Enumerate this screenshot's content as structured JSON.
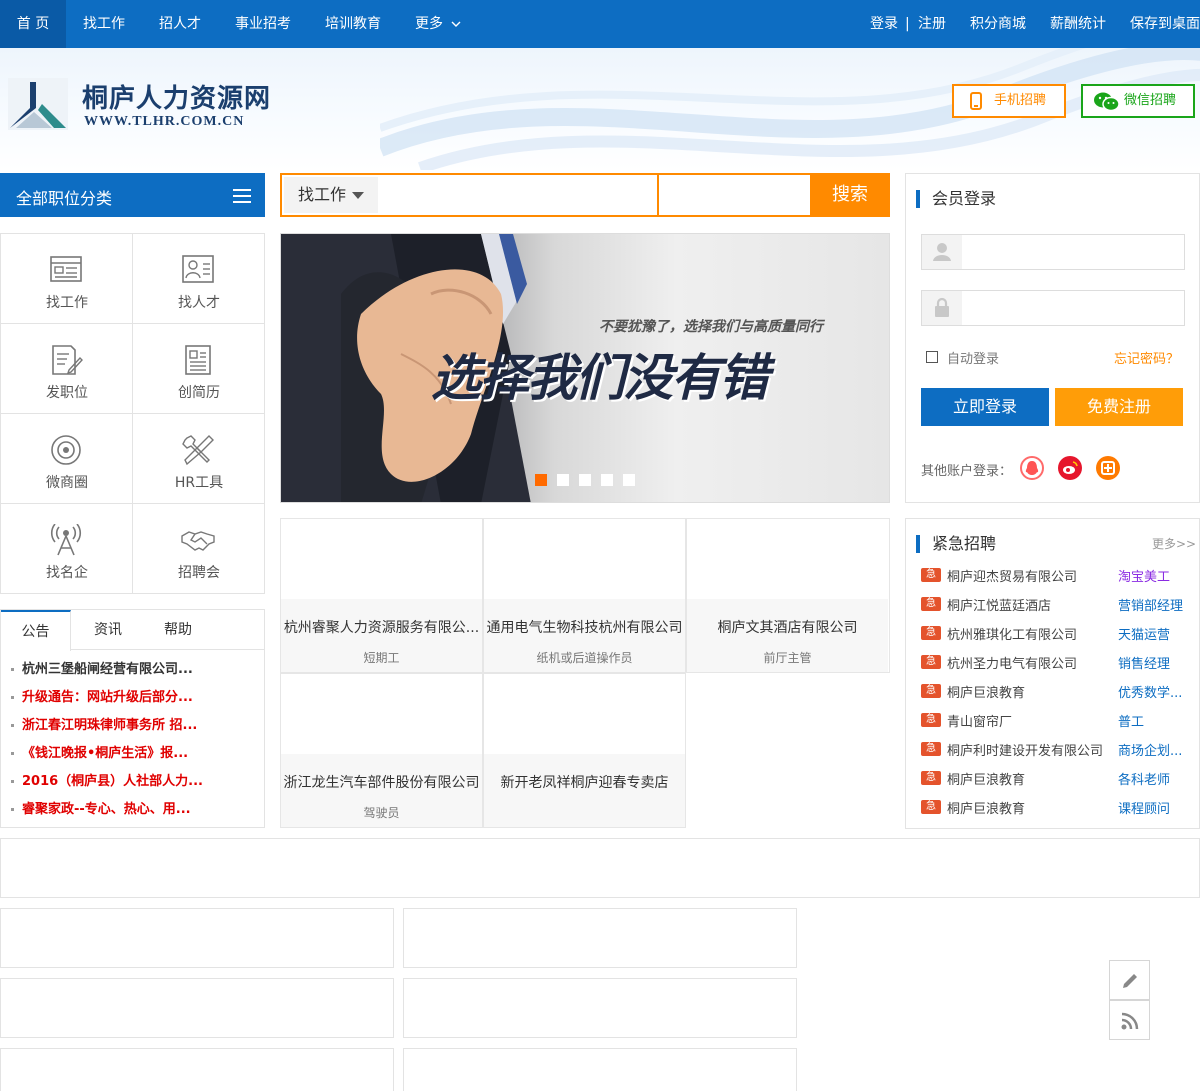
{
  "nav": {
    "items": [
      "首 页",
      "找工作",
      "招人才",
      "事业招考",
      "培训教育",
      "更多"
    ],
    "right": {
      "login": "登录",
      "sep": "|",
      "register": "注册",
      "points": "积分商城",
      "salary": "薪酬统计",
      "desktop": "保存到桌面"
    }
  },
  "header": {
    "logo_cn": "桐庐人力资源网",
    "logo_en": "WWW.TLHR.COM.CN",
    "mobile": "手机招聘",
    "wechat": "微信招聘"
  },
  "category": {
    "title": "全部职位分类",
    "cells": [
      {
        "label": "找工作",
        "icon": "job-search-icon"
      },
      {
        "label": "找人才",
        "icon": "resume-card-icon"
      },
      {
        "label": "发职位",
        "icon": "post-job-icon"
      },
      {
        "label": "创简历",
        "icon": "create-resume-icon"
      },
      {
        "label": "微商圈",
        "icon": "target-icon"
      },
      {
        "label": "HR工具",
        "icon": "tools-icon"
      },
      {
        "label": "找名企",
        "icon": "tower-icon"
      },
      {
        "label": "招聘会",
        "icon": "handshake-icon"
      }
    ]
  },
  "news": {
    "tabs": [
      "公告",
      "资讯",
      "帮助"
    ],
    "items": [
      {
        "text": "杭州三堡船闸经营有限公司...",
        "color": "#333333"
      },
      {
        "text": "升级通告：网站升级后部分...",
        "color": "#e00000"
      },
      {
        "text": "浙江春江明珠律师事务所 招...",
        "color": "#e00000"
      },
      {
        "text": "《钱江晚报•桐庐生活》报...",
        "color": "#e00000"
      },
      {
        "text": "2016（桐庐县）人社部人力...",
        "color": "#e00000"
      },
      {
        "text": "睿聚家政--专心、热心、用...",
        "color": "#e00000"
      }
    ]
  },
  "search": {
    "type": "找工作",
    "button": "搜索"
  },
  "banner": {
    "slogan": "选择我们没有错",
    "sub": "不要犹豫了，选择我们与高质量同行"
  },
  "companies": [
    {
      "name": "杭州睿聚人力资源服务有限公...",
      "job": "短期工"
    },
    {
      "name": "通用电气生物科技杭州有限公司",
      "job": "纸机或后道操作员"
    },
    {
      "name": "桐庐文其酒店有限公司",
      "job": "前厅主管"
    },
    {
      "name": "浙江龙生汽车部件股份有限公司",
      "job": "驾驶员"
    },
    {
      "name": "新开老凤祥桐庐迎春专卖店",
      "job": ""
    }
  ],
  "login": {
    "title": "会员登录",
    "auto": "自动登录",
    "forgot": "忘记密码？",
    "login_btn": "立即登录",
    "register_btn": "免费注册",
    "other": "其他账户登录："
  },
  "urgent": {
    "title": "紧急招聘",
    "more": "更多>>",
    "tag": "急",
    "items": [
      {
        "company": "桐庐迎杰贸易有限公司",
        "job": "淘宝美工",
        "color": "#8a2be2"
      },
      {
        "company": "桐庐江悦蓝廷酒店",
        "job": "营销部经理",
        "color": "#0d6dc2"
      },
      {
        "company": "杭州雅琪化工有限公司",
        "job": "天猫运营",
        "color": "#0d6dc2"
      },
      {
        "company": "杭州圣力电气有限公司",
        "job": "销售经理",
        "color": "#0d6dc2"
      },
      {
        "company": "桐庐巨浪教育",
        "job": "优秀数学...",
        "color": "#0d6dc2"
      },
      {
        "company": "青山窗帘厂",
        "job": "普工",
        "color": "#0d6dc2"
      },
      {
        "company": "桐庐利时建设开发有限公司",
        "job": "商场企划...",
        "color": "#0d6dc2"
      },
      {
        "company": "桐庐巨浪教育",
        "job": "各科老师",
        "color": "#0d6dc2"
      },
      {
        "company": "桐庐巨浪教育",
        "job": "课程顾问",
        "color": "#0d6dc2"
      }
    ]
  },
  "colors": {
    "brand_blue": "#0d6dc2",
    "orange": "#ff8a00",
    "green": "#1aa51a"
  }
}
